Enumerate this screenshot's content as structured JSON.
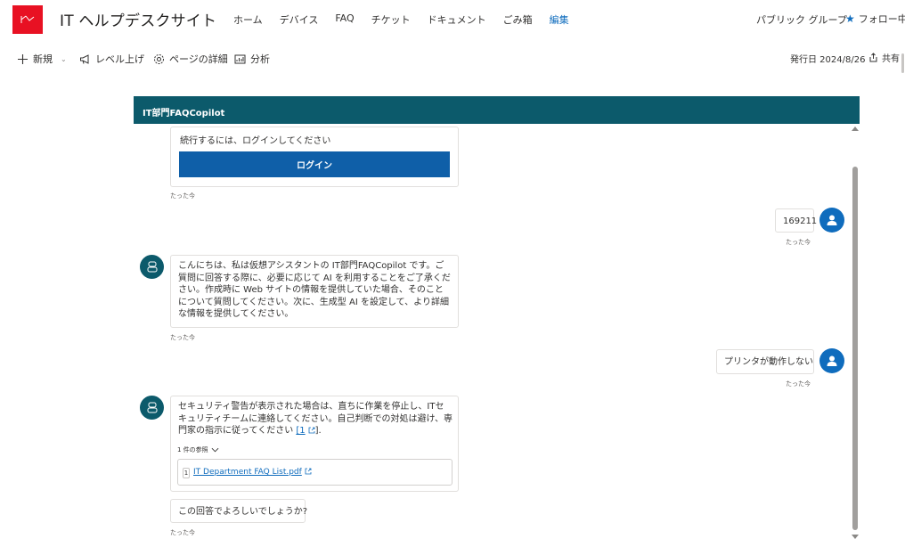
{
  "site": {
    "title": "IT ヘルプデスクサイト",
    "nav": [
      "ホーム",
      "デバイス",
      "FAQ",
      "チケット",
      "ドキュメント",
      "ごみ箱",
      "編集"
    ],
    "group_label": "パブリック グループ",
    "follow_label": "フォロー中"
  },
  "command_bar": {
    "new_label": "新規",
    "promote_label": "レベル上げ",
    "page_details_label": "ページの詳細",
    "analytics_label": "分析",
    "published": "発行日 2024/8/26",
    "share_label": "共有"
  },
  "chat": {
    "header_title": "IT部門FAQCopilot",
    "messages": [
      {
        "role": "bot",
        "text": "続行するには、ログインしてください",
        "button": "ログイン",
        "time": "たった今"
      },
      {
        "role": "user",
        "text": "169211",
        "time": "たった今"
      },
      {
        "role": "bot",
        "text": "こんにちは、私は仮想アシスタントの IT部門FAQCopilot です。ご質問に回答する際に、必要に応じて AI を利用することをご了承ください。作成時に Web サイトの情報を提供していた場合、そのことについて質問してください。次に、生成型 AI を設定して、より詳細な情報を提供してください。",
        "time": "たった今"
      },
      {
        "role": "user",
        "text": "プリンタが動作しない",
        "time": "たった今"
      },
      {
        "role": "bot",
        "text": "セキュリティ警告が表示された場合は、直ちに作業を停止し、ITセキュリティチームに連絡してください。自己判断での対処は避け、専門家の指示に従ってください",
        "citation": "[1",
        "text_end": "].",
        "references_toggle": "1 件の参照",
        "reference_num": "1",
        "reference_title": "IT Department FAQ List.pdf"
      },
      {
        "role": "bot",
        "text": "この回答でよろしいでしょうか?",
        "time": "たった今"
      }
    ]
  },
  "colors": {
    "brand_red": "#e81123",
    "header_teal": "#0c5a6b",
    "accent_blue": "#0f6cbd",
    "login_blue": "#0f5fa8"
  }
}
